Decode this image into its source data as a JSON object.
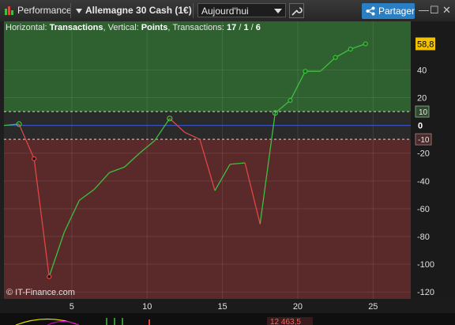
{
  "toolbar": {
    "performance_label": "Performance",
    "instrument_label": "Allemagne 30 Cash (1€)",
    "period_value": "Aujourd'hui",
    "share_label": "Partager",
    "minimize_glyph": "—",
    "maximize_glyph": "☐",
    "close_glyph": "✕"
  },
  "header": {
    "horizontal_prefix": "Horizontal: ",
    "horizontal_value": "Transactions",
    "vertical_prefix": ", Vertical: ",
    "vertical_value": "Points",
    "transactions_prefix": ", Transactions: ",
    "winners": "17",
    "slash1": " / ",
    "neutral": "1",
    "slash2": " / ",
    "losers": "6"
  },
  "axis": {
    "last_value_label": "58,8",
    "upper_band_label": "10",
    "lower_band_label": "-10",
    "zero_label": "0"
  },
  "footer": {
    "copyright": "© IT-Finance.com",
    "bottom_price": "12 463,5"
  },
  "colors": {
    "accent": "#2a7fc4",
    "gain_zone": "#2f6130",
    "loss_zone": "#5a2a2a",
    "up_line": "#3fbf3f",
    "down_line": "#e04545",
    "zero_line": "#3a55d6"
  },
  "chart_data": {
    "type": "line",
    "xlabel": "",
    "ylabel": "",
    "xlim": [
      0.5,
      27.5
    ],
    "ylim": [
      -125,
      75
    ],
    "x_ticks": [
      5,
      10,
      15,
      20,
      25
    ],
    "y_ticks": [
      40,
      20,
      0,
      -20,
      -40,
      -60,
      -80,
      -100,
      -120
    ],
    "y_tick_labels": [
      "40",
      "20",
      "0",
      "-20",
      "-40",
      "-60",
      "-80",
      "-100",
      "-120"
    ],
    "bands": [
      10,
      -10
    ],
    "grid": true,
    "series": [
      {
        "x": [
          0.5,
          1.5,
          2.5,
          3.5,
          4.5,
          5.5,
          6.5,
          7.5,
          8.5,
          9.5,
          10.5,
          11.5,
          12.5,
          13.5,
          14.5,
          15.5,
          16.5,
          17.5,
          18.5,
          19.5,
          20.5,
          21.5,
          22.5,
          23.5,
          24.5
        ],
        "y": [
          0,
          1,
          -24,
          -109,
          -77,
          -54,
          -46,
          -34,
          -30,
          -20,
          -11,
          5,
          -5,
          -10,
          -47,
          -28,
          -27,
          -71,
          9,
          18,
          39,
          39,
          49,
          55,
          58.8
        ],
        "markers": [
          1,
          2,
          3,
          11,
          18,
          19,
          20,
          22,
          23,
          24
        ]
      }
    ]
  }
}
